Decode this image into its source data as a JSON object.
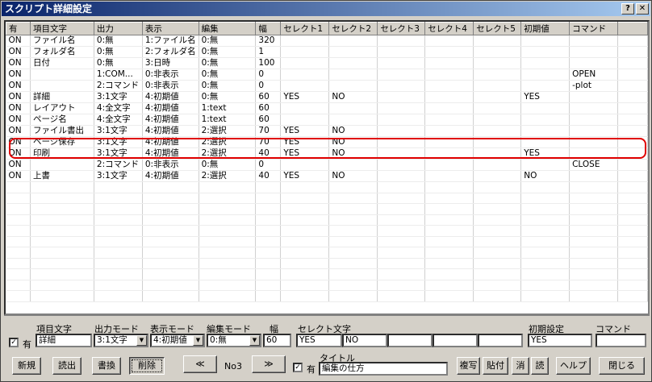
{
  "window": {
    "title": "スクリプト詳細設定",
    "help_glyph": "?",
    "close_glyph": "✕"
  },
  "grid": {
    "headers": [
      "有",
      "項目文字",
      "出力",
      "表示",
      "編集",
      "幅",
      "セレクト1",
      "セレクト2",
      "セレクト3",
      "セレクト4",
      "セレクト5",
      "初期値",
      "コマンド"
    ],
    "rows": [
      [
        "ON",
        "ファイル名",
        "0:無",
        "1:ファイル名",
        "0:無",
        "320",
        "",
        "",
        "",
        "",
        "",
        "",
        ""
      ],
      [
        "ON",
        "フォルダ名",
        "0:無",
        "2:フォルダ名",
        "0:無",
        "1",
        "",
        "",
        "",
        "",
        "",
        "",
        ""
      ],
      [
        "ON",
        "日付",
        "0:無",
        "3:日時",
        "0:無",
        "100",
        "",
        "",
        "",
        "",
        "",
        "",
        ""
      ],
      [
        "ON",
        "",
        "1:COM...",
        "0:非表示",
        "0:無",
        "0",
        "",
        "",
        "",
        "",
        "",
        "",
        "OPEN"
      ],
      [
        "ON",
        "",
        "2:コマンド",
        "0:非表示",
        "0:無",
        "0",
        "",
        "",
        "",
        "",
        "",
        "",
        "-plot"
      ],
      [
        "ON",
        "詳細",
        "3:1文字",
        "4:初期値",
        "0:無",
        "60",
        "YES",
        "NO",
        "",
        "",
        "",
        "YES",
        ""
      ],
      [
        "ON",
        "レイアウト",
        "4:全文字",
        "4:初期値",
        "1:text",
        "60",
        "",
        "",
        "",
        "",
        "",
        "",
        ""
      ],
      [
        "ON",
        "ページ名",
        "4:全文字",
        "4:初期値",
        "1:text",
        "60",
        "",
        "",
        "",
        "",
        "",
        "",
        ""
      ],
      [
        "ON",
        "ファイル書出",
        "3:1文字",
        "4:初期値",
        "2:選択",
        "70",
        "YES",
        "NO",
        "",
        "",
        "",
        "",
        ""
      ],
      [
        "ON",
        "ページ保存",
        "3:1文字",
        "4:初期値",
        "2:選択",
        "70",
        "YES",
        "NO",
        "",
        "",
        "",
        "",
        ""
      ],
      [
        "ON",
        "印刷",
        "3:1文字",
        "4:初期値",
        "2:選択",
        "40",
        "YES",
        "NO",
        "",
        "",
        "",
        "YES",
        ""
      ],
      [
        "ON",
        "",
        "2:コマンド",
        "0:非表示",
        "0:無",
        "0",
        "",
        "",
        "",
        "",
        "",
        "",
        "CLOSE"
      ],
      [
        "ON",
        "上書",
        "3:1文字",
        "4:初期値",
        "2:選択",
        "40",
        "YES",
        "NO",
        "",
        "",
        "",
        "NO",
        ""
      ]
    ]
  },
  "editor": {
    "enabled_label": "有",
    "enabled_check": "✓",
    "item_label": "項目文字",
    "item_value": "詳細",
    "output_label": "出力モード",
    "output_value": "3:1文字",
    "display_label": "表示モード",
    "display_value": "4:初期値",
    "edit_label": "編集モード",
    "edit_value": "0:無",
    "width_label": "幅",
    "width_value": "60",
    "select_label": "セレクト文字",
    "select_values": [
      "YES",
      "NO",
      "",
      "",
      ""
    ],
    "initial_label": "初期設定",
    "initial_value": "YES",
    "command_label": "コマンド",
    "command_value": "",
    "title_label": "タイトル",
    "title_check_label": "有",
    "title_value": "編集の仕方",
    "record_no": "No3"
  },
  "buttons": {
    "new": "新規",
    "load": "読出",
    "save": "書換",
    "delete": "削除",
    "prev": "≪",
    "next": "≫",
    "copy": "複写",
    "paste": "貼付",
    "erase": "消",
    "read": "読",
    "help": "ヘルプ",
    "close": "閉じる"
  },
  "icons": {
    "combo_arrow": "▼"
  }
}
